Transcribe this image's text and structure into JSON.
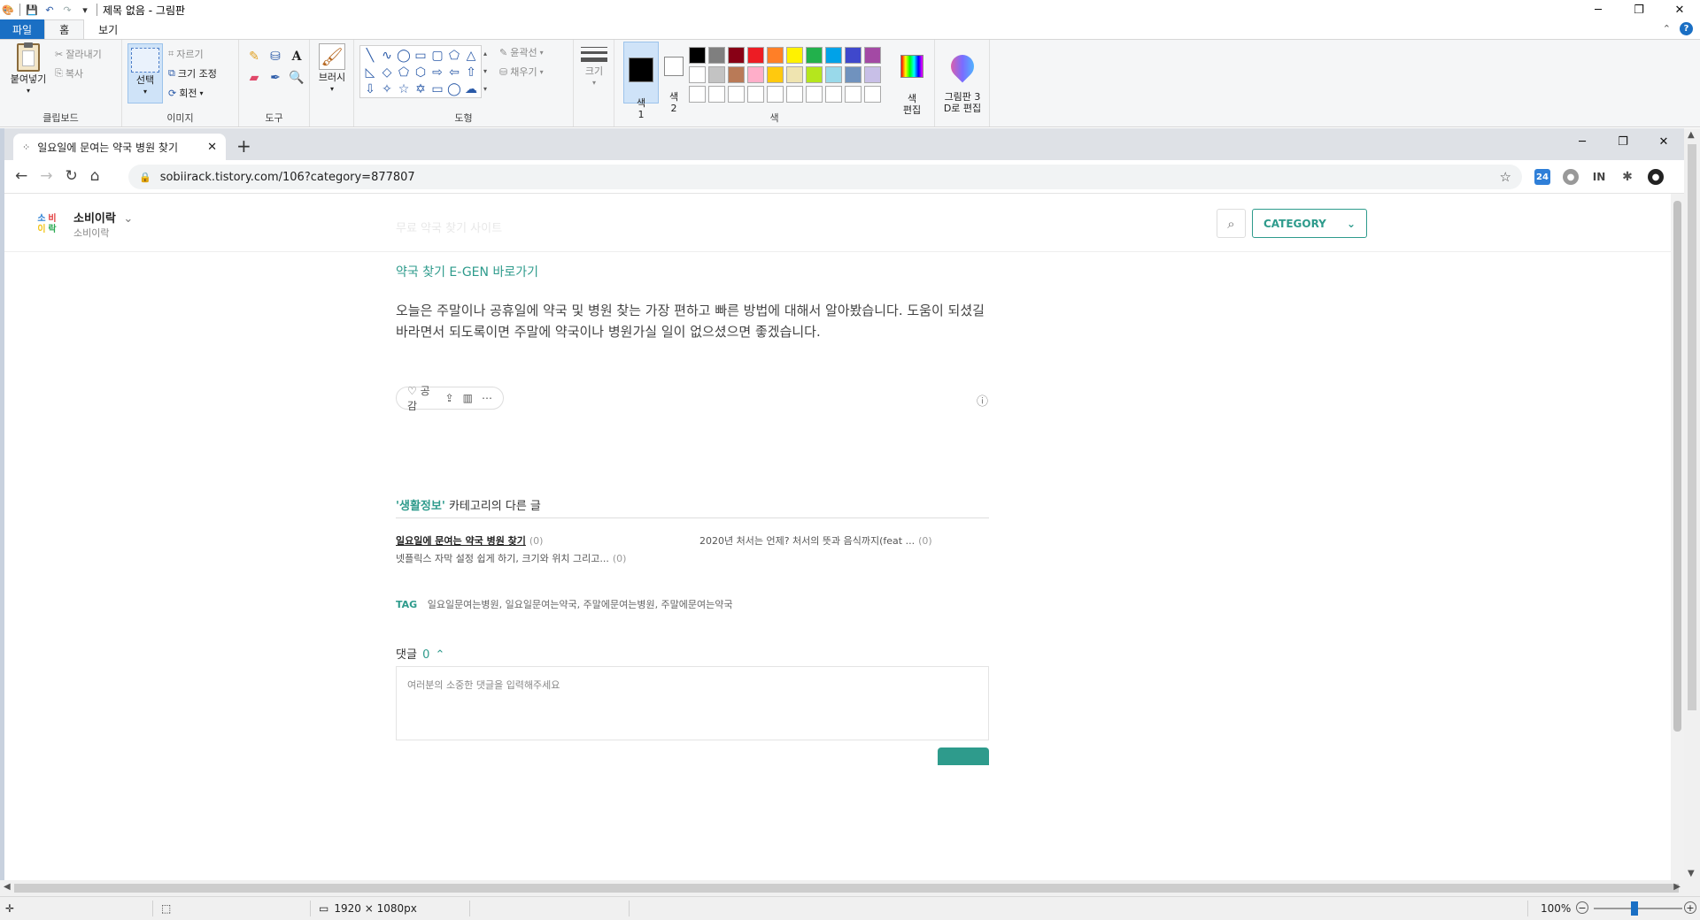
{
  "paint": {
    "title": "제목 없음 - 그림판",
    "tabs": [
      "파일",
      "홈",
      "보기"
    ],
    "ribbon": {
      "clipboard": {
        "paste": "붙여넣기",
        "cut": "잘라내기",
        "copy": "복사",
        "group": "클립보드"
      },
      "image": {
        "select": "선택",
        "crop": "자르기",
        "resize": "크기 조정",
        "rotate": "회전",
        "group": "이미지"
      },
      "tools": {
        "group": "도구"
      },
      "brushes": {
        "label": "브러시"
      },
      "shapes": {
        "outline": "윤곽선",
        "fill": "채우기",
        "group": "도형"
      },
      "size": {
        "label": "크기"
      },
      "colors": {
        "color1": "색\n1",
        "color2": "색\n2",
        "edit": "색\n편집",
        "group": "색",
        "palette": [
          "#000000",
          "#7f7f7f",
          "#880015",
          "#ed1c24",
          "#ff7f27",
          "#fff200",
          "#22b14c",
          "#00a2e8",
          "#3f48cc",
          "#a349a4",
          "#ffffff",
          "#c3c3c3",
          "#b97a57",
          "#ffaec9",
          "#ffc90e",
          "#efe4b0",
          "#b5e61d",
          "#99d9ea",
          "#7092be",
          "#c8bfe7",
          "#ffffff",
          "#ffffff",
          "#ffffff",
          "#ffffff",
          "#ffffff",
          "#ffffff",
          "#ffffff",
          "#ffffff",
          "#ffffff",
          "#ffffff"
        ]
      },
      "paint3d": "그림판 3\nD로 편집"
    },
    "status": {
      "dimensions": "1920 × 1080px",
      "zoom": "100%"
    }
  },
  "browser": {
    "tab_title": "일요일에 문여는 약국 병원 찾기",
    "url": "sobiirack.tistory.com/106?category=877807"
  },
  "blog": {
    "logo": [
      "소",
      "비",
      "이",
      "락"
    ],
    "logo_colors": [
      "#2a7fd4",
      "#e23b3b",
      "#f2c417",
      "#2faa55"
    ],
    "name": "소비이락",
    "subtitle": "소비이락",
    "faded_title": "무료 약국 찾기 사이트",
    "category_label": "CATEGORY",
    "accent": "#2e9b8c"
  },
  "article": {
    "link": "약국 찾기 E-GEN 바로가기",
    "paragraph": "오늘은 주말이나 공휴일에 약국 및 병원 찾는 가장 편하고 빠른 방법에 대해서 알아봤습니다. 도움이 되셨길 바라면서 되도록이면 주말에 약국이나 병원가실 일이 없으셨으면 좋겠습니다.",
    "like_label": "공감",
    "related": {
      "category": "'생활정보'",
      "suffix": " 카테고리의 다른 글",
      "items": [
        {
          "title": "일요일에 문여는 약국 병원 찾기",
          "count": "(0)"
        },
        {
          "title": "2020년 처서는 언제? 처서의 뜻과 음식까지(feat ...",
          "count": "(0)"
        },
        {
          "title": "넷플릭스 자막 설정 쉽게 하기, 크기와 위치 그리고...",
          "count": "(0)"
        }
      ]
    },
    "tag_label": "TAG",
    "tags": "일요일문여는병원, 일요일문여는약국, 주말에문여는병원, 주말에문여는약국",
    "comments_label": "댓글",
    "comments_count": "0",
    "comment_placeholder": "여러분의 소중한 댓글을 입력해주세요"
  }
}
